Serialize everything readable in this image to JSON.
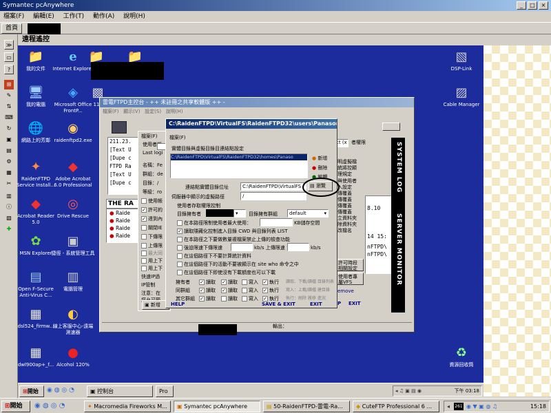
{
  "outer_window": {
    "title": "Symantec pcAnywhere"
  },
  "outer_menu": [
    "檔案(F)",
    "編輯(E)",
    "工作(T)",
    "動作(A)",
    "說明(H)"
  ],
  "tab": {
    "home": "首頁"
  },
  "section_header": "遠程遙控",
  "desktop_icons": [
    {
      "label": "我的文件",
      "glyph": "📁",
      "icon": "folder-icon"
    },
    {
      "label": "Internet Explorer",
      "glyph": "e",
      "icon": "ie-icon"
    },
    {
      "label": "我的電腦",
      "glyph": "🖥",
      "icon": "computer-icon"
    },
    {
      "label": "Microsoft Office FrontP...",
      "glyph": "◈",
      "icon": "frontpage-icon"
    },
    {
      "label": "網路上的芳鄰",
      "glyph": "🌐",
      "icon": "network-icon"
    },
    {
      "label": "raidenftpd2.exe",
      "glyph": "◉",
      "icon": "exe-icon"
    },
    {
      "label": "RaidenFTPD Service Install...",
      "glyph": "✦",
      "icon": "raiden-service-icon"
    },
    {
      "label": "Adobe Acrobat 6.0 Professional",
      "glyph": "◆",
      "icon": "acrobat-icon"
    },
    {
      "label": "Acrobat Reader 5.0",
      "glyph": "◆",
      "icon": "acrobat-reader-icon"
    },
    {
      "label": "Drive Rescue",
      "glyph": "◎",
      "icon": "drive-rescue-icon"
    },
    {
      "label": "MSN Explorer",
      "glyph": "✿",
      "icon": "msn-icon"
    },
    {
      "label": "捷徑 - 系統管理工具",
      "glyph": "▣",
      "icon": "admin-tools-icon"
    },
    {
      "label": "Open F-Secure Anti-Virus C...",
      "glyph": "▤",
      "icon": "fsecure-icon"
    },
    {
      "label": "電腦管理",
      "glyph": "▥",
      "icon": "computer-management-icon"
    },
    {
      "label": "dsl524_firmw...",
      "glyph": "▦",
      "icon": "firmware-icon"
    },
    {
      "label": "線上客服中心-遠端測速器",
      "glyph": "◐",
      "icon": "speedtest-icon"
    },
    {
      "label": "dwl900ap+_f...",
      "glyph": "▦",
      "icon": "dwl-icon"
    },
    {
      "label": "Alcohol 120%",
      "glyph": "●",
      "icon": "alcohol-icon"
    },
    {
      "label": "DSP-Link",
      "glyph": "▧",
      "icon": "dsplink-icon"
    },
    {
      "label": "Cable Manager",
      "glyph": "▨",
      "icon": "cable-manager-icon"
    },
    {
      "label": "資源回收筒",
      "glyph": "♻",
      "icon": "recycle-bin-icon"
    },
    {
      "label": "11",
      "glyph": "▩",
      "icon": "partial-icon"
    }
  ],
  "console": {
    "title": "雷電FTPD主控台 - ++ 未註冊之共享軟體版 ++ -",
    "menu": [
      "檔案(F)",
      "顯示(V)",
      "設定(S)",
      "說明(H)"
    ],
    "log_lines": [
      "211.23.",
      "[Text U",
      "[Dupe c",
      "FTPD Ra",
      "[Text U",
      "[Dupe c"
    ],
    "tree_items": [
      "Raide",
      "Raide",
      "Raide",
      "Raide"
    ],
    "banner": "THE RA",
    "left_panel": {
      "file_label": "檔案(F)",
      "user_account": "使用者帳",
      "last_login": "Last logi",
      "name": "名稱：Fe",
      "group": "群組：de",
      "directory": "目錄：/",
      "level": "等級：ro",
      "checks": [
        "使用帳",
        "許可約",
        "達到內",
        "關閉IE",
        "下傳限",
        "上傳限",
        "最大同",
        "用上下",
        "用上下"
      ],
      "quick_ip": "快速IP過",
      "ip_control": "IP管制",
      "note1": "注意：在",
      "note2": "您允可範",
      "add_user": "新增"
    },
    "right_panel": {
      "rights_label": "者權限",
      "partial_text": "ct (x",
      "items": [
        "明虛擬檔",
        "統將控顯",
        "理規定",
        "與使用者",
        "入設定",
        "傳覆蓋",
        "傳覆蓋",
        "傳覆蓋",
        "傳覆蓋",
        "立資料夾",
        "除資料夾",
        "改檔名"
      ],
      "log_nums": [
        "8.10",
        "14 15:",
        "nFTPD\\",
        "nFTPD\\"
      ],
      "btn_time": "許可時段",
      "btn_set": "相關設定",
      "btn_user": "使用者專",
      "btn_vfs": "屬VFS",
      "remove": "emove",
      "help_link": "P",
      "exit_link": "EXIT"
    },
    "side_text_1": "SYSTEM LOG",
    "side_text_2": "SERVER MONITOR",
    "status_output": "輸出："
  },
  "vfs_dialog": {
    "title": "C:\\RaidenFTPD\\VirtualFS\\RaidenFTPD32\\users\\Panasonic.vfs",
    "menu_file": "檔案(F)",
    "group_label": "實體目錄與虛擬目錄目連結點設定",
    "list_item": "C:\\RaidenFTPD\\VirtualFS\\RaidenFTPD32\\homes\\Panaso",
    "btn_add": "新增",
    "btn_delete": "刪除",
    "btn_edit": "編輯",
    "btn_browse": "瀏覽",
    "phys_label": "連結點實體目錄位址",
    "phys_value": "C:\\RaidenFTPD\\VirtualFS",
    "virt_label": "伺服器中顯示的虛擬路徑",
    "virt_value": "/",
    "access_label": "使用者存取權限控制",
    "owner_label": "目錄擁有者",
    "owner_group_label": "目錄擁有群組",
    "owner_group_value": "default",
    "options": [
      {
        "text": "在本路徑限制使用者最大使用：",
        "checked": false
      },
      {
        "text": "讀取隱藏化控制進入目錄 CWD 與目錄列表 LIST",
        "checked": true
      },
      {
        "text": "在本路徑之下要做數量複檔案禁止上傳的檢查功能",
        "checked": false
      },
      {
        "text": "強迫限速下傳限速",
        "checked": false
      },
      {
        "text": "在這個路徑下不要計算統計資料",
        "checked": false
      },
      {
        "text": "在這個路徑下的活動不要被顯示在 site who 命令之中",
        "checked": false
      },
      {
        "text": "在這個路徑下即使沒有下載額度也可以下載",
        "checked": false
      }
    ],
    "kb_space": "KB儲存空間",
    "kbs1": "kb/s 上傳限速",
    "kbs2": "kb/s",
    "perm_rows": [
      {
        "who": "擁有者",
        "read": true,
        "write": true,
        "write2": false,
        "exec": true,
        "hint": "讀取、下載/讀檔 目錄列表"
      },
      {
        "who": "同群組",
        "read": true,
        "write": true,
        "write2": false,
        "exec": true,
        "hint": "寫入：上載/讀檔 建目錄"
      },
      {
        "who": "其它群組",
        "read": true,
        "write": false,
        "write2": false,
        "exec": true,
        "hint": "執行：刪除 搬移 進況"
      }
    ],
    "perm_labels": {
      "read": "讀取",
      "write": "寫入",
      "exec": "執行"
    },
    "help": "HELP",
    "save_exit": "SAVE & EXIT",
    "exit": "EXIT"
  },
  "inner_taskbar": {
    "start": "開始",
    "items": [
      "控制台",
      "Pro"
    ],
    "time": "下午 03:18"
  },
  "taskbar": {
    "start": "開始",
    "items": [
      "Macromedia Fireworks M...",
      "Symantec pcAnywhere",
      "50-RaidenFTPD-雷電-Ra...",
      "CuteFTP Professional 6 ..."
    ],
    "tray_num": "261",
    "time": "15:18"
  },
  "colors": {
    "desktop": "#1c2c9c",
    "title": "#0a246a",
    "console_title": "#5c7fb5",
    "annotation": "#000000"
  }
}
